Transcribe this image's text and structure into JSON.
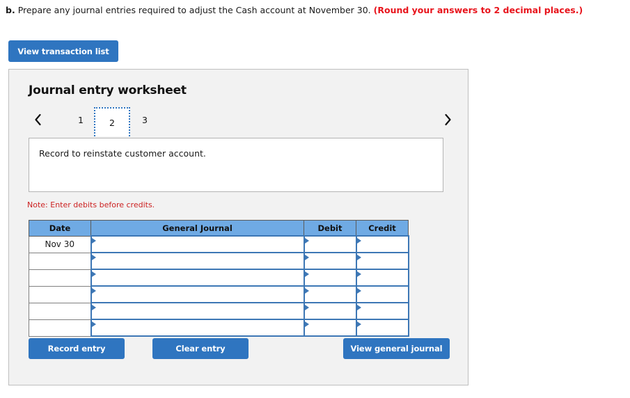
{
  "question": {
    "label": "b.",
    "text": "Prepare any journal entries required to adjust the Cash account at November 30.",
    "note": "(Round your answers to 2 decimal places.)"
  },
  "toolbar": {
    "view_transaction_list_label": "View transaction list"
  },
  "worksheet": {
    "title": "Journal entry worksheet",
    "pager": {
      "prev_icon": "chevron-left-icon",
      "next_icon": "chevron-right-icon",
      "pages": [
        "1",
        "2",
        "3"
      ],
      "active_page": "2"
    },
    "description": "Record to reinstate customer account.",
    "note": "Note: Enter debits before credits.",
    "table": {
      "headers": [
        "Date",
        "General Journal",
        "Debit",
        "Credit"
      ],
      "rows": [
        {
          "date": "Nov 30",
          "general_journal": "",
          "debit": "",
          "credit": ""
        },
        {
          "date": "",
          "general_journal": "",
          "debit": "",
          "credit": ""
        },
        {
          "date": "",
          "general_journal": "",
          "debit": "",
          "credit": ""
        },
        {
          "date": "",
          "general_journal": "",
          "debit": "",
          "credit": ""
        },
        {
          "date": "",
          "general_journal": "",
          "debit": "",
          "credit": ""
        },
        {
          "date": "",
          "general_journal": "",
          "debit": "",
          "credit": ""
        }
      ]
    },
    "actions": {
      "record_entry_label": "Record entry",
      "clear_entry_label": "Clear entry",
      "view_general_journal_label": "View general journal"
    }
  },
  "colors": {
    "button_blue": "#2f75c0",
    "table_header_blue": "#6faae4",
    "input_border_blue": "#3d77b5",
    "note_red": "#cc2222",
    "question_note_red": "#e8141c",
    "panel_background": "#f2f2f2"
  }
}
